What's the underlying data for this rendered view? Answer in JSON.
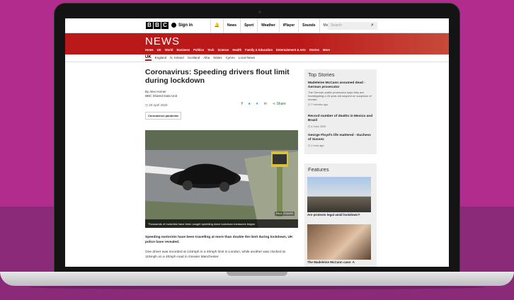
{
  "topbar": {
    "logo": [
      "B",
      "B",
      "C"
    ],
    "signin": "Sign in",
    "nav": [
      "News",
      "Sport",
      "Weather",
      "iPlayer",
      "Sounds"
    ],
    "more": "More",
    "search_placeholder": "Search"
  },
  "banner": {
    "title": "NEWS",
    "links": [
      "Home",
      "UK",
      "World",
      "Business",
      "Politics",
      "Tech",
      "Science",
      "Health",
      "Family & Education",
      "Entertainment & Arts",
      "Stories",
      "More"
    ]
  },
  "subnav": [
    "UK",
    "England",
    "N. Ireland",
    "Scotland",
    "Alba",
    "Wales",
    "Cymru",
    "Local News"
  ],
  "article": {
    "headline": "Coronavirus: Speeding drivers flout limit during lockdown",
    "author": "By Alex Homer",
    "unit": "BBC Shared Data Unit",
    "date": "20 April 2020",
    "share_label": "Share",
    "tag": "Coronavirus pandemic",
    "caption": "Thousands of motorists have been caught speeding since lockdown measures began",
    "credit": "PAUL CRAVEN",
    "lead": "Speeding motorists have been travelling at more than double the limit during lockdown, UK police have revealed.",
    "para": "One driver was recorded at 134mph in a 40mph limit in London, while another was clocked at 115mph on a 40mph road in Greater Manchester."
  },
  "top_stories": {
    "title": "Top Stories",
    "items": [
      {
        "title": "Madeleine McCann assumed dead - German prosecutor",
        "desc": "The German public prosecutor says they are investigating a 43-year-old suspect on suspicion of murder.",
        "time": "7 minutes ago"
      },
      {
        "title": "Record number of deaths in Mexico and Brazil",
        "desc": "",
        "time": "4 June 2020"
      },
      {
        "title": "George Floyd's life mattered - Duchess of Sussex",
        "desc": "",
        "time": "1 hour ago"
      }
    ]
  },
  "features": {
    "title": "Features",
    "items": [
      {
        "title": "Are protests legal amid lockdown?"
      },
      {
        "title": "The Madeleine McCann case: A"
      }
    ]
  }
}
